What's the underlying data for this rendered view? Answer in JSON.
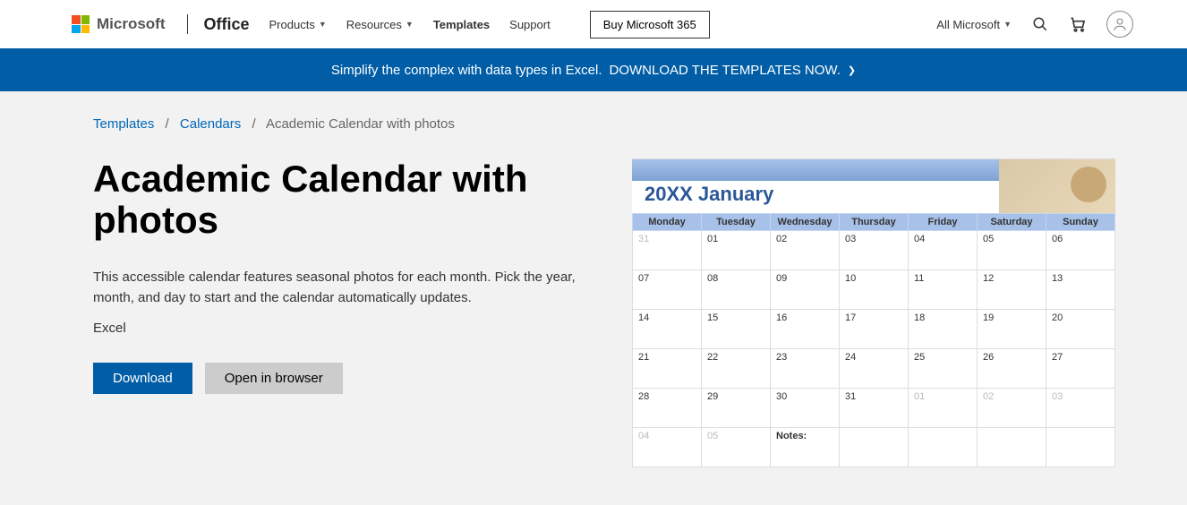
{
  "header": {
    "microsoft": "Microsoft",
    "office": "Office",
    "nav": {
      "products": "Products",
      "resources": "Resources",
      "templates": "Templates",
      "support": "Support"
    },
    "buy": "Buy Microsoft 365",
    "allMicrosoft": "All Microsoft"
  },
  "banner": {
    "lead": "Simplify the complex with data types in Excel.",
    "cta": "DOWNLOAD THE TEMPLATES NOW."
  },
  "breadcrumb": {
    "templates": "Templates",
    "calendars": "Calendars",
    "current": "Academic Calendar with photos"
  },
  "page": {
    "title": "Academic Calendar with photos",
    "description": "This accessible calendar features seasonal photos for each month. Pick the year, month, and day to start and the calendar automatically updates.",
    "app": "Excel",
    "download": "Download",
    "open": "Open in browser"
  },
  "preview": {
    "title": "20XX January",
    "days": [
      "Monday",
      "Tuesday",
      "Wednesday",
      "Thursday",
      "Friday",
      "Saturday",
      "Sunday"
    ],
    "weeks": [
      [
        "31",
        "01",
        "02",
        "03",
        "04",
        "05",
        "06"
      ],
      [
        "07",
        "08",
        "09",
        "10",
        "11",
        "12",
        "13"
      ],
      [
        "14",
        "15",
        "16",
        "17",
        "18",
        "19",
        "20"
      ],
      [
        "21",
        "22",
        "23",
        "24",
        "25",
        "26",
        "27"
      ],
      [
        "28",
        "29",
        "30",
        "31",
        "01",
        "02",
        "03"
      ],
      [
        "04",
        "05",
        "Notes:",
        "",
        "",
        "",
        ""
      ]
    ]
  }
}
